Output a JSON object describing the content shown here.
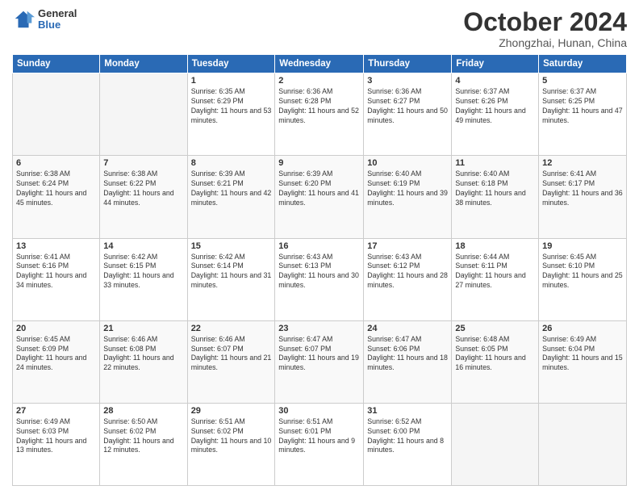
{
  "header": {
    "logo_general": "General",
    "logo_blue": "Blue",
    "title": "October 2024",
    "location": "Zhongzhai, Hunan, China"
  },
  "days_of_week": [
    "Sunday",
    "Monday",
    "Tuesday",
    "Wednesday",
    "Thursday",
    "Friday",
    "Saturday"
  ],
  "weeks": [
    [
      {
        "day": "",
        "info": ""
      },
      {
        "day": "",
        "info": ""
      },
      {
        "day": "1",
        "info": "Sunrise: 6:35 AM\nSunset: 6:29 PM\nDaylight: 11 hours and 53 minutes."
      },
      {
        "day": "2",
        "info": "Sunrise: 6:36 AM\nSunset: 6:28 PM\nDaylight: 11 hours and 52 minutes."
      },
      {
        "day": "3",
        "info": "Sunrise: 6:36 AM\nSunset: 6:27 PM\nDaylight: 11 hours and 50 minutes."
      },
      {
        "day": "4",
        "info": "Sunrise: 6:37 AM\nSunset: 6:26 PM\nDaylight: 11 hours and 49 minutes."
      },
      {
        "day": "5",
        "info": "Sunrise: 6:37 AM\nSunset: 6:25 PM\nDaylight: 11 hours and 47 minutes."
      }
    ],
    [
      {
        "day": "6",
        "info": "Sunrise: 6:38 AM\nSunset: 6:24 PM\nDaylight: 11 hours and 45 minutes."
      },
      {
        "day": "7",
        "info": "Sunrise: 6:38 AM\nSunset: 6:22 PM\nDaylight: 11 hours and 44 minutes."
      },
      {
        "day": "8",
        "info": "Sunrise: 6:39 AM\nSunset: 6:21 PM\nDaylight: 11 hours and 42 minutes."
      },
      {
        "day": "9",
        "info": "Sunrise: 6:39 AM\nSunset: 6:20 PM\nDaylight: 11 hours and 41 minutes."
      },
      {
        "day": "10",
        "info": "Sunrise: 6:40 AM\nSunset: 6:19 PM\nDaylight: 11 hours and 39 minutes."
      },
      {
        "day": "11",
        "info": "Sunrise: 6:40 AM\nSunset: 6:18 PM\nDaylight: 11 hours and 38 minutes."
      },
      {
        "day": "12",
        "info": "Sunrise: 6:41 AM\nSunset: 6:17 PM\nDaylight: 11 hours and 36 minutes."
      }
    ],
    [
      {
        "day": "13",
        "info": "Sunrise: 6:41 AM\nSunset: 6:16 PM\nDaylight: 11 hours and 34 minutes."
      },
      {
        "day": "14",
        "info": "Sunrise: 6:42 AM\nSunset: 6:15 PM\nDaylight: 11 hours and 33 minutes."
      },
      {
        "day": "15",
        "info": "Sunrise: 6:42 AM\nSunset: 6:14 PM\nDaylight: 11 hours and 31 minutes."
      },
      {
        "day": "16",
        "info": "Sunrise: 6:43 AM\nSunset: 6:13 PM\nDaylight: 11 hours and 30 minutes."
      },
      {
        "day": "17",
        "info": "Sunrise: 6:43 AM\nSunset: 6:12 PM\nDaylight: 11 hours and 28 minutes."
      },
      {
        "day": "18",
        "info": "Sunrise: 6:44 AM\nSunset: 6:11 PM\nDaylight: 11 hours and 27 minutes."
      },
      {
        "day": "19",
        "info": "Sunrise: 6:45 AM\nSunset: 6:10 PM\nDaylight: 11 hours and 25 minutes."
      }
    ],
    [
      {
        "day": "20",
        "info": "Sunrise: 6:45 AM\nSunset: 6:09 PM\nDaylight: 11 hours and 24 minutes."
      },
      {
        "day": "21",
        "info": "Sunrise: 6:46 AM\nSunset: 6:08 PM\nDaylight: 11 hours and 22 minutes."
      },
      {
        "day": "22",
        "info": "Sunrise: 6:46 AM\nSunset: 6:07 PM\nDaylight: 11 hours and 21 minutes."
      },
      {
        "day": "23",
        "info": "Sunrise: 6:47 AM\nSunset: 6:07 PM\nDaylight: 11 hours and 19 minutes."
      },
      {
        "day": "24",
        "info": "Sunrise: 6:47 AM\nSunset: 6:06 PM\nDaylight: 11 hours and 18 minutes."
      },
      {
        "day": "25",
        "info": "Sunrise: 6:48 AM\nSunset: 6:05 PM\nDaylight: 11 hours and 16 minutes."
      },
      {
        "day": "26",
        "info": "Sunrise: 6:49 AM\nSunset: 6:04 PM\nDaylight: 11 hours and 15 minutes."
      }
    ],
    [
      {
        "day": "27",
        "info": "Sunrise: 6:49 AM\nSunset: 6:03 PM\nDaylight: 11 hours and 13 minutes."
      },
      {
        "day": "28",
        "info": "Sunrise: 6:50 AM\nSunset: 6:02 PM\nDaylight: 11 hours and 12 minutes."
      },
      {
        "day": "29",
        "info": "Sunrise: 6:51 AM\nSunset: 6:02 PM\nDaylight: 11 hours and 10 minutes."
      },
      {
        "day": "30",
        "info": "Sunrise: 6:51 AM\nSunset: 6:01 PM\nDaylight: 11 hours and 9 minutes."
      },
      {
        "day": "31",
        "info": "Sunrise: 6:52 AM\nSunset: 6:00 PM\nDaylight: 11 hours and 8 minutes."
      },
      {
        "day": "",
        "info": ""
      },
      {
        "day": "",
        "info": ""
      }
    ]
  ]
}
